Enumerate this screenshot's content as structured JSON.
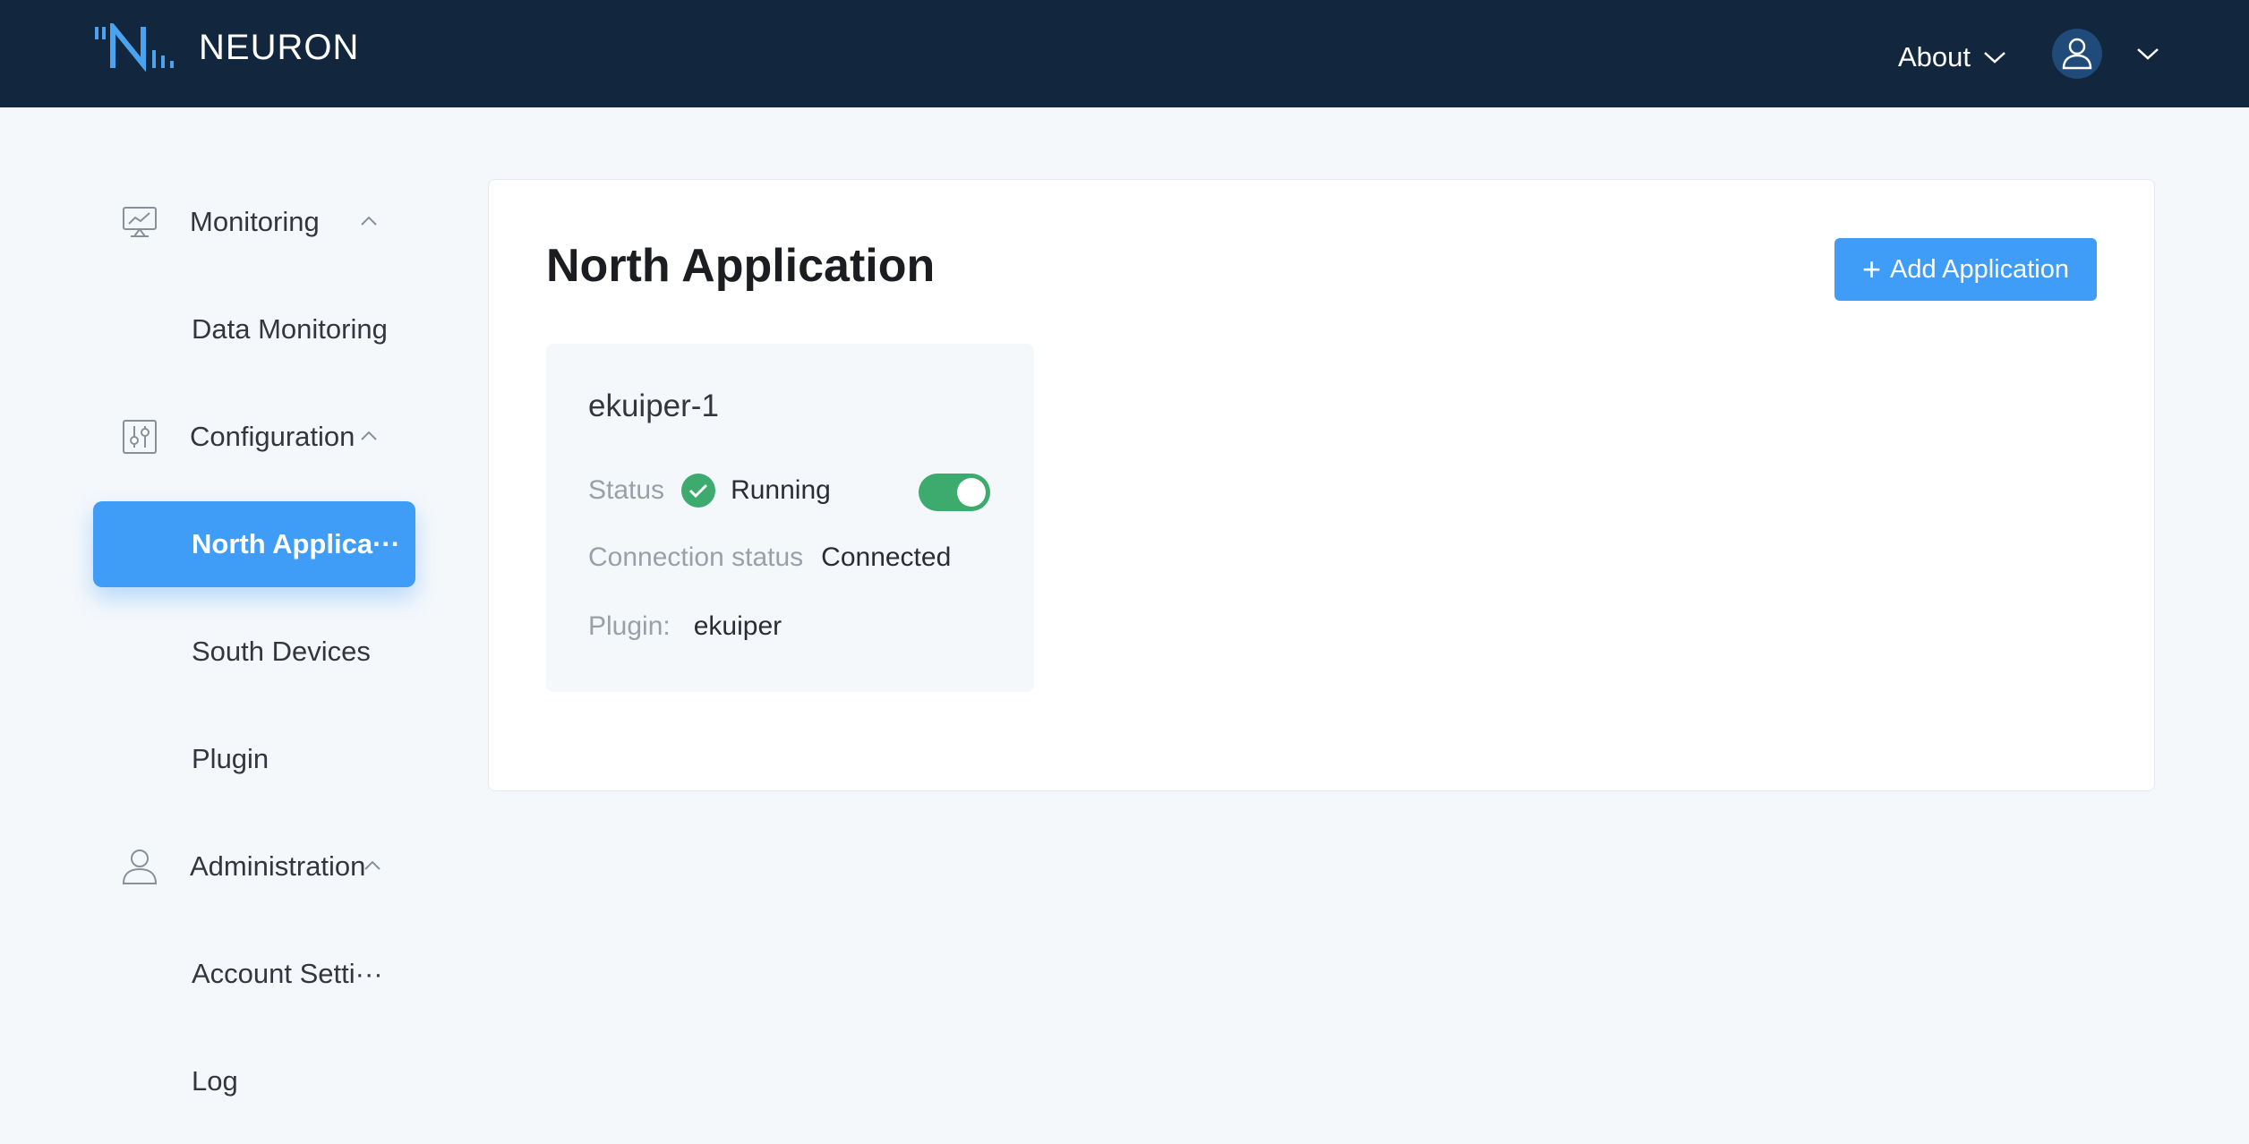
{
  "header": {
    "app_name": "NEURON",
    "about_label": "About"
  },
  "sidebar": {
    "groups": [
      {
        "label": "Monitoring",
        "icon": "monitor-chart-icon",
        "items": [
          {
            "label": "Data Monitoring",
            "active": false
          }
        ]
      },
      {
        "label": "Configuration",
        "icon": "sliders-icon",
        "items": [
          {
            "label": "North Applica···",
            "active": true
          },
          {
            "label": "South Devices",
            "active": false
          },
          {
            "label": "Plugin",
            "active": false
          }
        ]
      },
      {
        "label": "Administration",
        "icon": "user-icon",
        "items": [
          {
            "label": "Account Setti···",
            "active": false
          },
          {
            "label": "Log",
            "active": false
          }
        ]
      }
    ]
  },
  "main": {
    "title": "North Application",
    "add_button_label": "Add Application",
    "cards": [
      {
        "name": "ekuiper-1",
        "status_label": "Status",
        "status_value": "Running",
        "running": true,
        "connection_label": "Connection status",
        "connection_value": "Connected",
        "plugin_label": "Plugin:",
        "plugin_value": "ekuiper"
      }
    ]
  },
  "colors": {
    "header_bg": "#12273d",
    "accent": "#3f9df8",
    "running_green": "#3daa6e",
    "page_bg": "#f5f8fb"
  }
}
